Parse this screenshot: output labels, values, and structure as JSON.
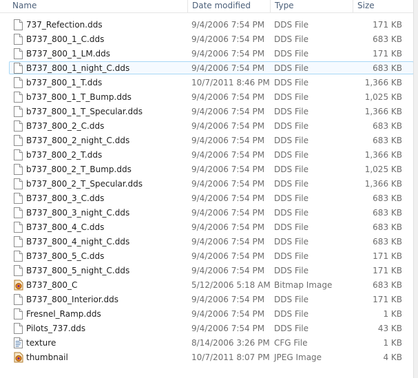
{
  "columns": {
    "name": "Name",
    "date": "Date modified",
    "type": "Type",
    "size": "Size"
  },
  "files": [
    {
      "name": "737_Refection.dds",
      "date": "9/4/2006 7:54 PM",
      "type": "DDS File",
      "size": "171 KB",
      "icon": "file-icon"
    },
    {
      "name": "B737_800_1_C.dds",
      "date": "9/4/2006 7:54 PM",
      "type": "DDS File",
      "size": "683 KB",
      "icon": "file-icon"
    },
    {
      "name": "B737_800_1_LM.dds",
      "date": "9/4/2006 7:54 PM",
      "type": "DDS File",
      "size": "171 KB",
      "icon": "file-icon"
    },
    {
      "name": "B737_800_1_night_C.dds",
      "date": "9/4/2006 7:54 PM",
      "type": "DDS File",
      "size": "683 KB",
      "icon": "file-icon",
      "selected": true
    },
    {
      "name": "b737_800_1_T.dds",
      "date": "10/7/2011 8:46 PM",
      "type": "DDS File",
      "size": "1,366 KB",
      "icon": "file-icon"
    },
    {
      "name": "b737_800_1_T_Bump.dds",
      "date": "9/4/2006 7:54 PM",
      "type": "DDS File",
      "size": "1,025 KB",
      "icon": "file-icon"
    },
    {
      "name": "b737_800_1_T_Specular.dds",
      "date": "9/4/2006 7:54 PM",
      "type": "DDS File",
      "size": "1,366 KB",
      "icon": "file-icon"
    },
    {
      "name": "B737_800_2_C.dds",
      "date": "9/4/2006 7:54 PM",
      "type": "DDS File",
      "size": "683 KB",
      "icon": "file-icon"
    },
    {
      "name": "B737_800_2_night_C.dds",
      "date": "9/4/2006 7:54 PM",
      "type": "DDS File",
      "size": "683 KB",
      "icon": "file-icon"
    },
    {
      "name": "b737_800_2_T.dds",
      "date": "9/4/2006 7:54 PM",
      "type": "DDS File",
      "size": "1,366 KB",
      "icon": "file-icon"
    },
    {
      "name": "b737_800_2_T_Bump.dds",
      "date": "9/4/2006 7:54 PM",
      "type": "DDS File",
      "size": "1,025 KB",
      "icon": "file-icon"
    },
    {
      "name": "b737_800_2_T_Specular.dds",
      "date": "9/4/2006 7:54 PM",
      "type": "DDS File",
      "size": "1,366 KB",
      "icon": "file-icon"
    },
    {
      "name": "B737_800_3_C.dds",
      "date": "9/4/2006 7:54 PM",
      "type": "DDS File",
      "size": "683 KB",
      "icon": "file-icon"
    },
    {
      "name": "B737_800_3_night_C.dds",
      "date": "9/4/2006 7:54 PM",
      "type": "DDS File",
      "size": "683 KB",
      "icon": "file-icon"
    },
    {
      "name": "B737_800_4_C.dds",
      "date": "9/4/2006 7:54 PM",
      "type": "DDS File",
      "size": "683 KB",
      "icon": "file-icon"
    },
    {
      "name": "B737_800_4_night_C.dds",
      "date": "9/4/2006 7:54 PM",
      "type": "DDS File",
      "size": "683 KB",
      "icon": "file-icon"
    },
    {
      "name": "B737_800_5_C.dds",
      "date": "9/4/2006 7:54 PM",
      "type": "DDS File",
      "size": "171 KB",
      "icon": "file-icon"
    },
    {
      "name": "B737_800_5_night_C.dds",
      "date": "9/4/2006 7:54 PM",
      "type": "DDS File",
      "size": "171 KB",
      "icon": "file-icon"
    },
    {
      "name": "B737_800_C",
      "date": "5/12/2006 5:18 AM",
      "type": "Bitmap Image",
      "size": "683 KB",
      "icon": "image-icon"
    },
    {
      "name": "B737_800_Interior.dds",
      "date": "9/4/2006 7:54 PM",
      "type": "DDS File",
      "size": "171 KB",
      "icon": "file-icon"
    },
    {
      "name": "Fresnel_Ramp.dds",
      "date": "9/4/2006 7:54 PM",
      "type": "DDS File",
      "size": "1 KB",
      "icon": "file-icon"
    },
    {
      "name": "Pilots_737.dds",
      "date": "9/4/2006 7:54 PM",
      "type": "DDS File",
      "size": "43 KB",
      "icon": "file-icon"
    },
    {
      "name": "texture",
      "date": "8/14/2006 3:26 PM",
      "type": "CFG File",
      "size": "1 KB",
      "icon": "config-file-icon"
    },
    {
      "name": "thumbnail",
      "date": "10/7/2011 8:07 PM",
      "type": "JPEG Image",
      "size": "4 KB",
      "icon": "image-icon"
    }
  ],
  "colors": {
    "selection_border": "#a8d8f6",
    "selection_fill": "#f5faff",
    "header_text": "#4c607a"
  }
}
